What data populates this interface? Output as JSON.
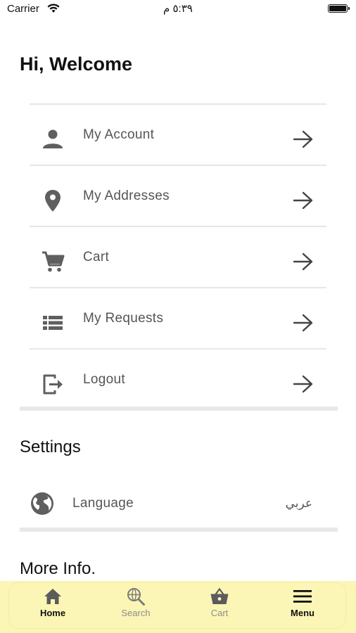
{
  "status_bar": {
    "carrier": "Carrier",
    "time": "٥:٣٩ م"
  },
  "greeting": "Hi, Welcome",
  "menu": {
    "items": [
      {
        "label": "My Account",
        "icon": "person-icon"
      },
      {
        "label": "My Addresses",
        "icon": "location-pin-icon"
      },
      {
        "label": "Cart",
        "icon": "cart-icon"
      },
      {
        "label": "My Requests",
        "icon": "list-icon"
      },
      {
        "label": "Logout",
        "icon": "logout-icon"
      }
    ]
  },
  "settings": {
    "title": "Settings",
    "language_label": "Language",
    "language_value": "عربي"
  },
  "more_info_title": "More Info.",
  "tab_bar": {
    "tabs": [
      {
        "label": "Home",
        "icon": "home-icon",
        "active": true
      },
      {
        "label": "Search",
        "icon": "search-globe-icon",
        "active": false
      },
      {
        "label": "Cart",
        "icon": "basket-icon",
        "active": false
      },
      {
        "label": "Menu",
        "icon": "hamburger-menu-icon",
        "active": true
      }
    ]
  },
  "colors": {
    "tab_bar_background": "#fbf6b6",
    "icon_gray": "#5f5f5f",
    "divider": "#e6e6e6"
  }
}
